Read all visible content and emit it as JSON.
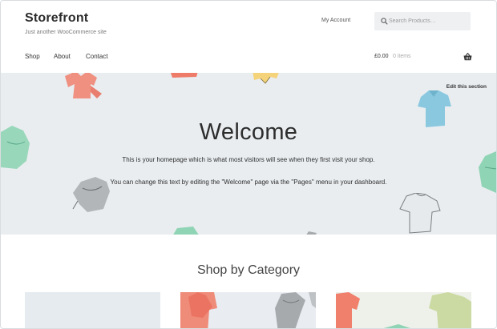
{
  "header": {
    "site_title": "Storefront",
    "tagline": "Just another WooCommerce site",
    "my_account": "My Account",
    "search_placeholder": "Search Products…"
  },
  "nav": {
    "items": [
      {
        "label": "Shop"
      },
      {
        "label": "About"
      },
      {
        "label": "Contact"
      }
    ]
  },
  "cart": {
    "total": "£0.00",
    "items": "0 items",
    "icon": "basket-icon"
  },
  "hero": {
    "edit_label": "Edit this section",
    "title": "Welcome",
    "line1": "This is your homepage which is what most visitors will see when they first visit your shop.",
    "line2": "You can change this text by editing the \"Welcome\" page via the \"Pages\" menu in your dashboard."
  },
  "categories": {
    "title": "Shop by Category"
  },
  "colors": {
    "hero_bg": "#e9edf0",
    "coral": "#f07f6c",
    "mint": "#8fd4b4",
    "blue": "#8ac8e0",
    "yellow": "#f4d37a",
    "gray": "#a7aaad"
  }
}
